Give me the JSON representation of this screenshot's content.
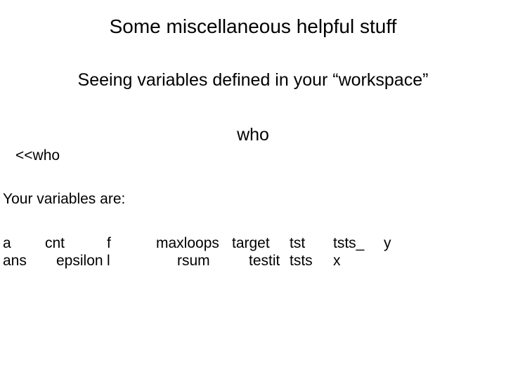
{
  "title": "Some miscellaneous helpful stuff",
  "subtitle": "Seeing variables defined in your “workspace”",
  "command": "who",
  "prompt": "<<who",
  "vars_label": "Your variables are:",
  "vars": {
    "row1": {
      "c0": "a",
      "c1": "cnt",
      "c2": "f",
      "c3": "maxloops",
      "c4": "target",
      "c5": "tst",
      "c6": "tsts_",
      "c7": "y"
    },
    "row2": {
      "c0": "ans",
      "c1": "epsilon",
      "c2": "l",
      "c3": "rsum",
      "c4": "testit",
      "c5": "tsts",
      "c6": "x",
      "c7": ""
    }
  }
}
